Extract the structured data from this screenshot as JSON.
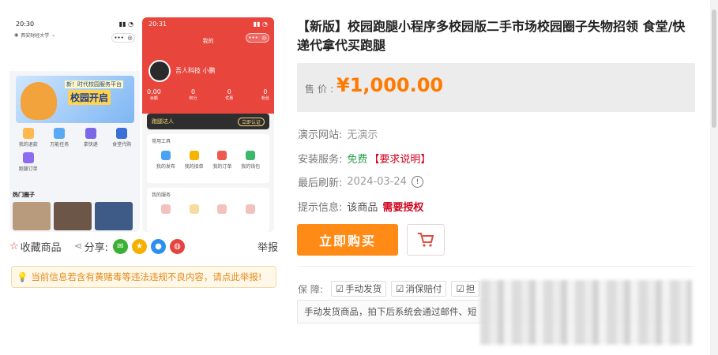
{
  "mockup_left": {
    "status_time": "20:30",
    "location": "西安财经大学",
    "banner_top_text": "新！时代校园服务平台",
    "banner_text": "校园开启",
    "icons": [
      "我的退款",
      "万能任务",
      "拿快递",
      "食堂代购",
      "跑腿订单"
    ],
    "hot_title": "热门圈子"
  },
  "mockup_right": {
    "status_time": "20:31",
    "header_title": "我的",
    "username": "吾人科技 小鹏",
    "stats": [
      {
        "value": "0.00",
        "label": "余额"
      },
      {
        "value": "0",
        "label": "积分"
      },
      {
        "value": "0",
        "label": "优惠"
      },
      {
        "value": "0",
        "label": "粉丝"
      }
    ],
    "runner_label": "跑腿达人",
    "runner_button": "立即认证",
    "tools_title": "常用工具",
    "tools": [
      "我的发布",
      "我的接单",
      "我的订单",
      "我的钱包"
    ],
    "services_title": "我的服务"
  },
  "share": {
    "favorite": "收藏商品",
    "share_label": "分享:",
    "report": "举报"
  },
  "notice": "当前信息若含有黄赌毒等违法违规不良内容，请点此举报!",
  "product": {
    "title": "【新版】校园跑腿小程序多校园版二手市场校园圈子失物招领 食堂/快递代拿代买跑腿",
    "price_label": "售价:",
    "price": "¥1,000.00",
    "demo_label": "演示网站:",
    "demo_value": "无演示",
    "install_label": "安装服务:",
    "install_value": "免费",
    "install_link": "【要求说明】",
    "refresh_label": "最后刷新:",
    "refresh_value": "2024-03-24",
    "tip_label": "提示信息:",
    "tip_value": "该商品",
    "tip_highlight": "需要授权",
    "buy_button": "立即购买",
    "guarantee_label": "保 障:",
    "guarantees": [
      "手动发货",
      "消保赔付",
      "担"
    ],
    "description": "手动发货商品，拍下后系统会通过邮件、短"
  },
  "colors": {
    "accent": "#ff7a00",
    "red_header": "#e8453c",
    "green": "#2aa04a",
    "danger": "#d0021b"
  }
}
